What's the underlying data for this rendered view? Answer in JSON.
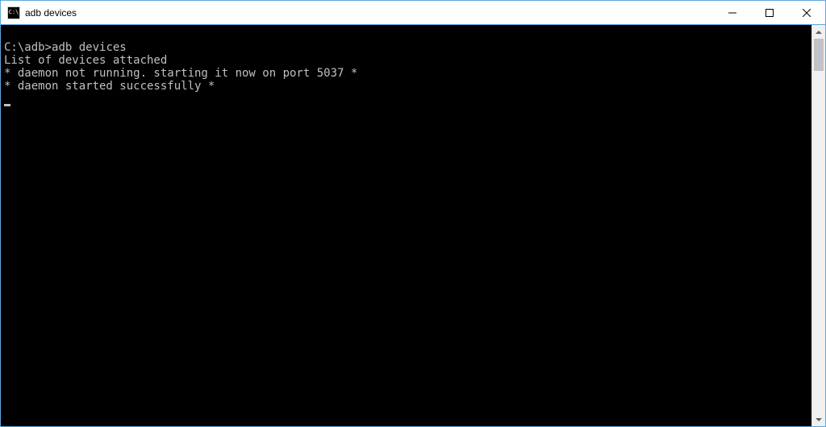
{
  "window": {
    "title": "adb devices",
    "icon_text": "C:\\"
  },
  "terminal": {
    "prompt": "C:\\adb>",
    "command": "adb devices",
    "lines": [
      "List of devices attached",
      "* daemon not running. starting it now on port 5037 *",
      "* daemon started successfully *"
    ]
  }
}
